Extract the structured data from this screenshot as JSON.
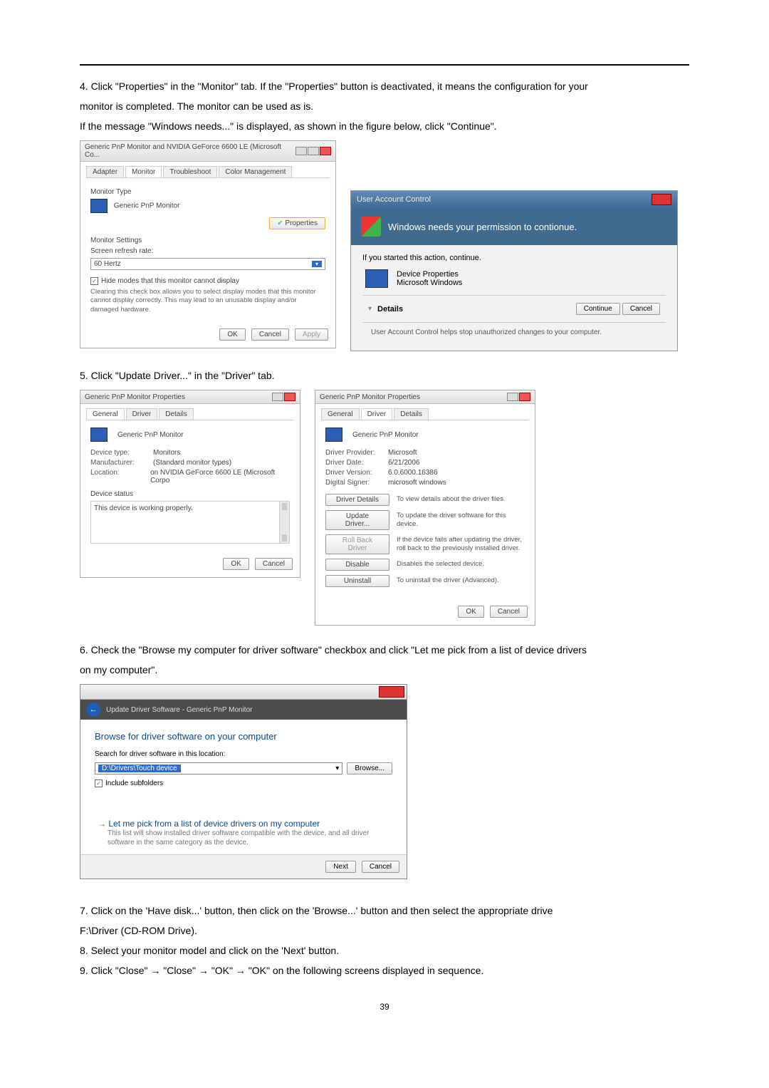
{
  "step4": {
    "line1": "4. Click \"Properties\" in the \"Monitor\" tab. If the \"Properties\" button is deactivated, it means the configuration for your",
    "line2": "monitor is completed. The monitor can be used as is.",
    "line3": "If the message \"Windows needs...\" is displayed, as shown in the figure below, click \"Continue\"."
  },
  "monitor_dialog": {
    "title": "Generic PnP Monitor and NVIDIA GeForce 6600 LE (Microsoft Co...",
    "tabs": {
      "adapter": "Adapter",
      "monitor": "Monitor",
      "troubleshoot": "Troubleshoot",
      "color": "Color Management"
    },
    "type_label": "Monitor Type",
    "type_value": "Generic PnP Monitor",
    "properties_btn": "Properties",
    "settings_label": "Monitor Settings",
    "refresh_label": "Screen refresh rate:",
    "refresh_value": "60 Hertz",
    "hide_chk": "Hide modes that this monitor cannot display",
    "hide_note": "Clearing this check box allows you to select display modes that this monitor cannot display correctly. This may lead to an unusable display and/or damaged hardware.",
    "ok": "OK",
    "cancel": "Cancel",
    "apply": "Apply"
  },
  "uac": {
    "title": "User Account Control",
    "banner": "Windows needs your permission to contionue.",
    "ifstarted": "If you started this action, continue.",
    "dev1": "Device Properties",
    "dev2": "Microsoft Windows",
    "details": "Details",
    "continue": "Continue",
    "cancel": "Cancel",
    "foot": "User Account Control helps stop unauthorized changes to your computer."
  },
  "step5": "5.  Click \"Update Driver...\" in the \"Driver\" tab.",
  "props1": {
    "title": "Generic PnP Monitor Properties",
    "tabs": {
      "general": "General",
      "driver": "Driver",
      "details": "Details"
    },
    "name": "Generic PnP Monitor",
    "kv": {
      "devtype_k": "Device type:",
      "devtype_v": "Monitors",
      "manu_k": "Manufacturer:",
      "manu_v": "(Standard monitor types)",
      "loc_k": "Location:",
      "loc_v": "on NVIDIA GeForce 6600 LE (Microsoft Corpo"
    },
    "status_label": "Device status",
    "status_text": "This device is working properly.",
    "ok": "OK",
    "cancel": "Cancel"
  },
  "props2": {
    "title": "Generic PnP Monitor Properties",
    "tabs": {
      "general": "General",
      "driver": "Driver",
      "details": "Details"
    },
    "name": "Generic PnP Monitor",
    "kv": {
      "prov_k": "Driver Provider:",
      "prov_v": "Microsoft",
      "date_k": "Driver Date:",
      "date_v": "6/21/2006",
      "ver_k": "Driver Version:",
      "ver_v": "6.0.6000.16386",
      "sig_k": "Digital Signer:",
      "sig_v": "microsoft windows"
    },
    "b_details": "Driver Details",
    "b_details_t": "To view details about the driver files.",
    "b_update": "Update Driver...",
    "b_update_t": "To update the driver software for this device.",
    "b_roll": "Roll Back Driver",
    "b_roll_t": "If the device fails after updating the driver, roll back to the previously installed driver.",
    "b_disable": "Disable",
    "b_disable_t": "Disables the selected device.",
    "b_uninst": "Uninstall",
    "b_uninst_t": "To uninstall the driver (Advanced).",
    "ok": "OK",
    "cancel": "Cancel"
  },
  "step6": {
    "line1": "6.  Check the \"Browse my computer for driver software\" checkbox and click \"Let me pick from a list of device drivers",
    "line2": "on my computer\"."
  },
  "wiz": {
    "breadcrumb": "Update Driver Software - Generic PnP Monitor",
    "heading": "Browse for driver software on your computer",
    "search_label": "Search for driver software in this location:",
    "path_value": "D:\\Drivers\\Touch device",
    "browse": "Browse...",
    "include": "Include subfolders",
    "lk_title": "Let me pick from a list of device drivers on my computer",
    "lk_sub": "This list will show installed driver software compatible with the device, and all driver software in the same category as the device.",
    "next": "Next",
    "cancel": "Cancel"
  },
  "step7": {
    "line1": "7.  Click on the 'Have disk...' button, then click on the 'Browse...' button and then select the appropriate drive",
    "line2": "F:\\Driver (CD-ROM Drive)."
  },
  "step8": "8.  Select your monitor model and click on the 'Next' button.",
  "step9": "9.  Click \"Close\"  →  \"Close\"  →  \"OK\"  →  \"OK\" on the following screens displayed in sequence.",
  "page_number": "39"
}
